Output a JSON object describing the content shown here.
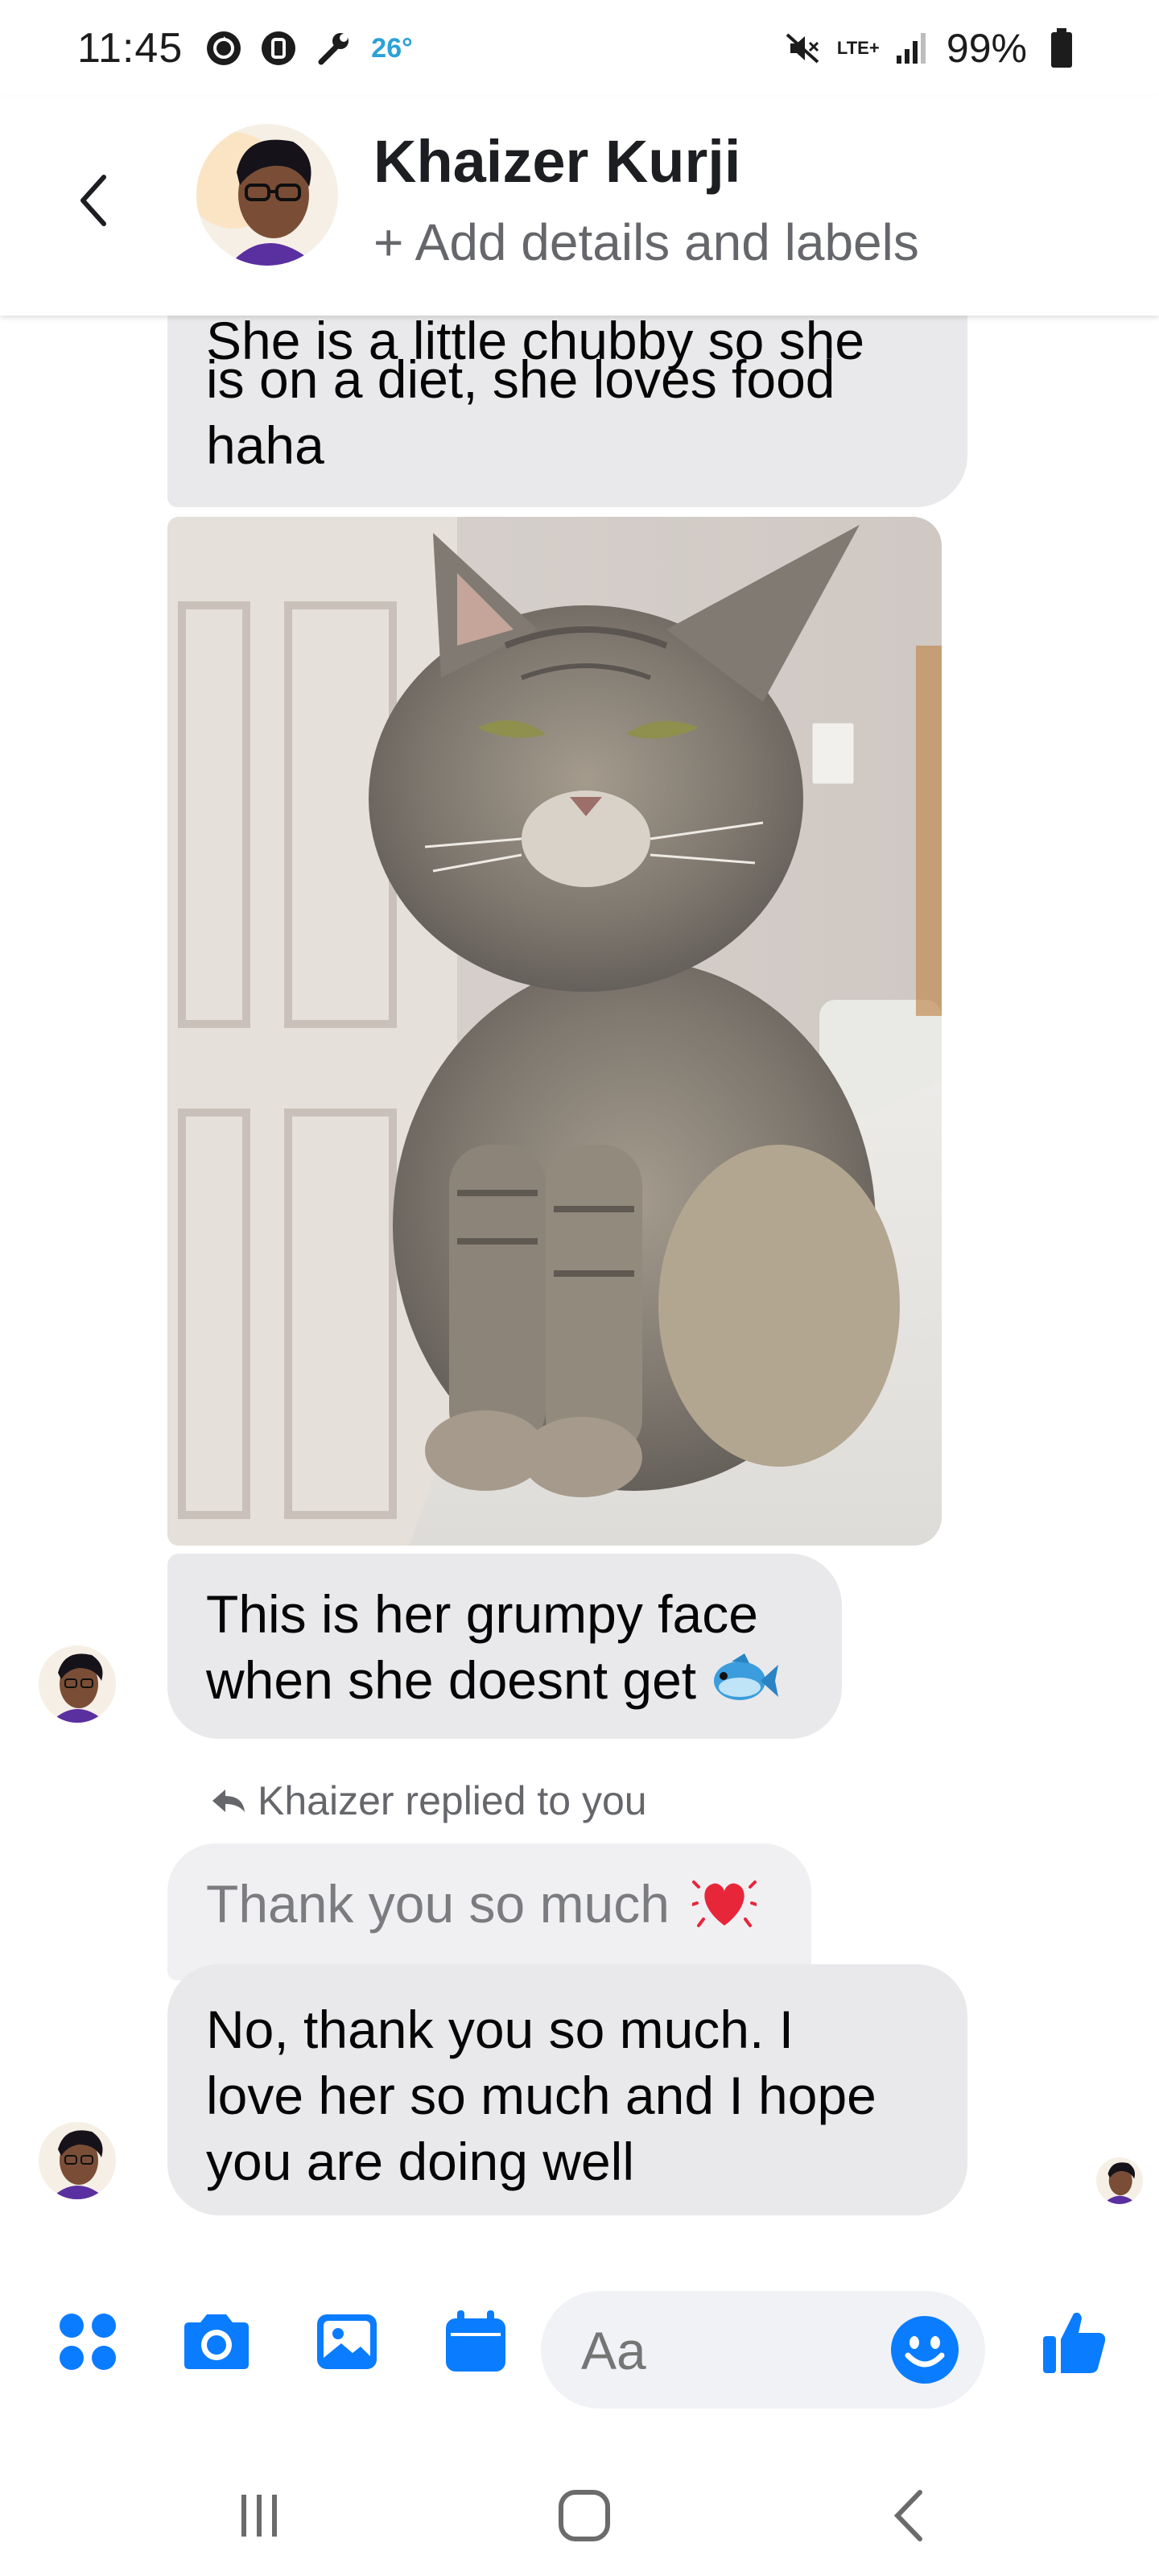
{
  "status_bar": {
    "time": "11:45",
    "temperature": "26°",
    "network": "LTE+",
    "battery": "99%",
    "icons": [
      "sync-icon",
      "data-saver-icon",
      "wrench-icon",
      "mute-icon",
      "signal-icon",
      "battery-icon"
    ]
  },
  "header": {
    "back_icon": "chevron-left-icon",
    "contact_name": "Khaizer Kurji",
    "subtitle": "+ Add details and labels"
  },
  "messages": [
    {
      "sender": "contact",
      "type": "text",
      "lines": [
        "She is a little chubby so she",
        "is on a diet, she loves food",
        "haha"
      ]
    },
    {
      "sender": "contact",
      "type": "photo",
      "photo": "grumpy-grey-cat-photo"
    },
    {
      "sender": "contact",
      "type": "text",
      "lines": [
        "This is her grumpy face",
        "when she doesnt get"
      ],
      "trailing_emoji": "fish-emoji"
    },
    {
      "sender": "contact",
      "type": "reply",
      "reply_note": "Khaizer replied to you",
      "quoted_text": "Thank you so much",
      "quoted_emoji": "beating-heart-emoji",
      "lines": [
        "No, thank you so much. I",
        "love her so much and I hope",
        "you are doing well"
      ]
    }
  ],
  "composer": {
    "placeholder": "Aa",
    "icons": [
      "apps-icon",
      "camera-icon",
      "gallery-icon",
      "calendar-icon",
      "emoji-icon",
      "like-icon"
    ]
  },
  "nav": {
    "icons": [
      "recent-apps-icon",
      "home-icon",
      "back-icon"
    ]
  },
  "colors": {
    "accent": "#0a7cff",
    "bubble": "#e9e9eb",
    "secondary_text": "#65676b"
  }
}
